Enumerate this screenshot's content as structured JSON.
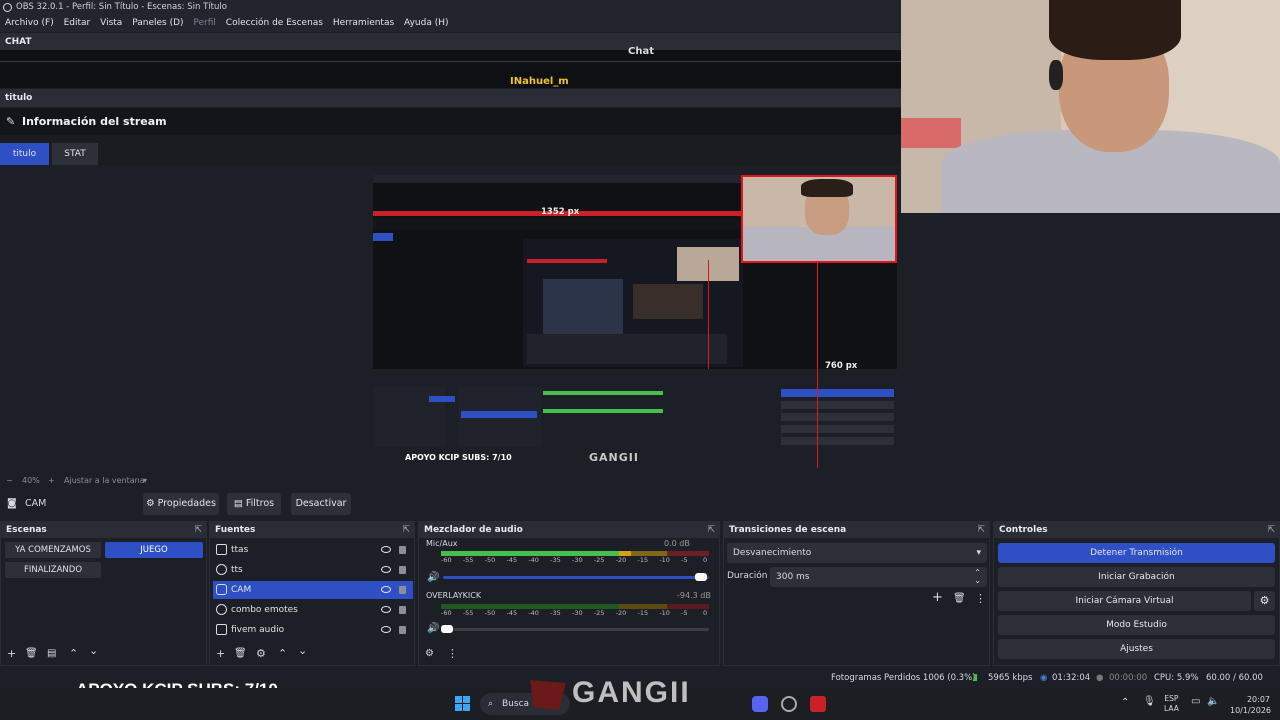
{
  "window": {
    "title": "OBS 32.0.1 - Perfil: Sin Título - Escenas: Sin Título"
  },
  "menu": [
    "Archivo (F)",
    "Editar",
    "Vista",
    "Paneles (D)",
    "Perfil",
    "Colección de Escenas",
    "Herramientas",
    "Ayuda (H)"
  ],
  "chat_dock": {
    "header": "CHAT",
    "title": "Chat",
    "user": "INahuel_m"
  },
  "title_dock": {
    "header": "titulo",
    "heading": "Información del stream",
    "tabs": [
      "titulo",
      "STAT"
    ]
  },
  "preview": {
    "width_label": "1352 px",
    "height_label": "760 px",
    "overlay_text": "APOYO KCIP SUBS: 7/10",
    "overlay_logo": "GANGII"
  },
  "zoom": {
    "level": "40%",
    "fit_label": "Ajustar a la ventana"
  },
  "source_toolbar": {
    "selected": "CAM",
    "properties": "Propiedades",
    "filters": "Filtros",
    "deactivate": "Desactivar"
  },
  "scenes": {
    "header": "Escenas",
    "items": [
      "YA COMENZAMOS",
      "JUEGO",
      "FINALIZANDO"
    ],
    "active": "JUEGO"
  },
  "sources": {
    "header": "Fuentes",
    "items": [
      "ttas",
      "tts",
      "CAM",
      "combo emotes",
      "fivem audio"
    ],
    "selected": "CAM"
  },
  "mixer": {
    "header": "Mezclador de audio",
    "channels": [
      {
        "name": "Mic/Aux",
        "db": "0.0 dB",
        "volume_fraction": 1.0
      },
      {
        "name": "OVERLAYKICK",
        "db": "-94.3 dB",
        "volume_fraction": 0.08
      }
    ],
    "scale": [
      "-60",
      "-55",
      "-50",
      "-45",
      "-40",
      "-35",
      "-30",
      "-25",
      "-20",
      "-15",
      "-10",
      "-5",
      "0"
    ]
  },
  "transitions": {
    "header": "Transiciones de escena",
    "selected": "Desvanecimiento",
    "duration_label": "Duración",
    "duration": "300 ms"
  },
  "controls": {
    "header": "Controles",
    "buttons": [
      "Detener Transmisión",
      "Iniciar Grabación",
      "Iniciar Cámara Virtual",
      "Modo Estudio",
      "Ajustes"
    ]
  },
  "status": {
    "dropped": "Fotogramas Perdidos 1006 (0.3%)",
    "bitrate": "5965 kbps",
    "stream_time": "01:32:04",
    "rec_time": "00:00:00",
    "cpu": "CPU: 5.9%",
    "fps": "60.00 / 60.00 FPS"
  },
  "stream_overlay": {
    "text": "APOYO KCIP SUBS: 7/10",
    "logo": "GANGII"
  },
  "taskbar": {
    "search": "Busca",
    "lang": "ESP",
    "lang2": "LAA",
    "time": "20:07",
    "date": "10/1/2026"
  },
  "colors": {
    "accent": "#2f4fc4",
    "bg": "#1d1f26",
    "panel": "#2a2d36",
    "button": "#2d3039",
    "red": "#e3141e"
  }
}
